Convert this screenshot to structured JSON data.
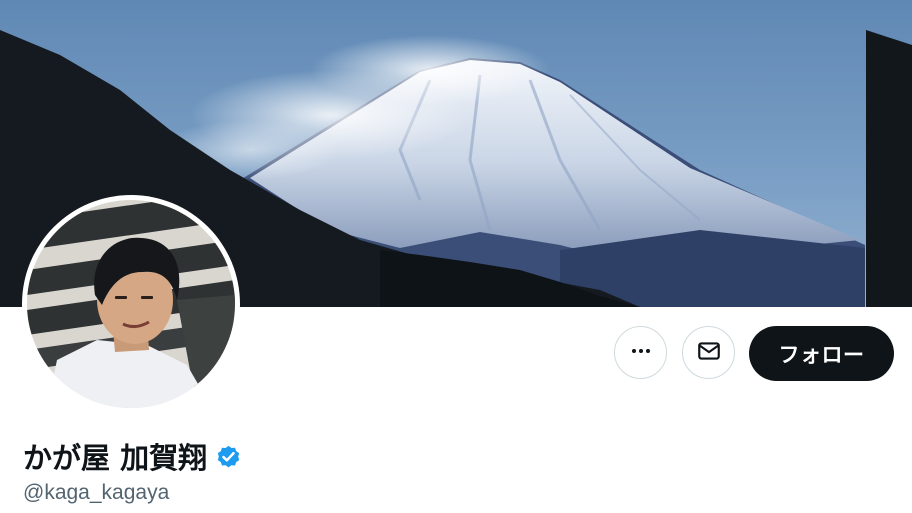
{
  "profile": {
    "display_name": "かが屋 加賀翔",
    "handle": "@kaga_kagaya",
    "verified": true
  },
  "actions": {
    "more_icon": "more-horizontal-icon",
    "message_icon": "envelope-icon",
    "follow_label": "フォロー"
  },
  "colors": {
    "follow_bg": "#0f1419",
    "verified_blue": "#1d9bf0",
    "handle_gray": "#536471",
    "border_gray": "#cfd9de"
  }
}
